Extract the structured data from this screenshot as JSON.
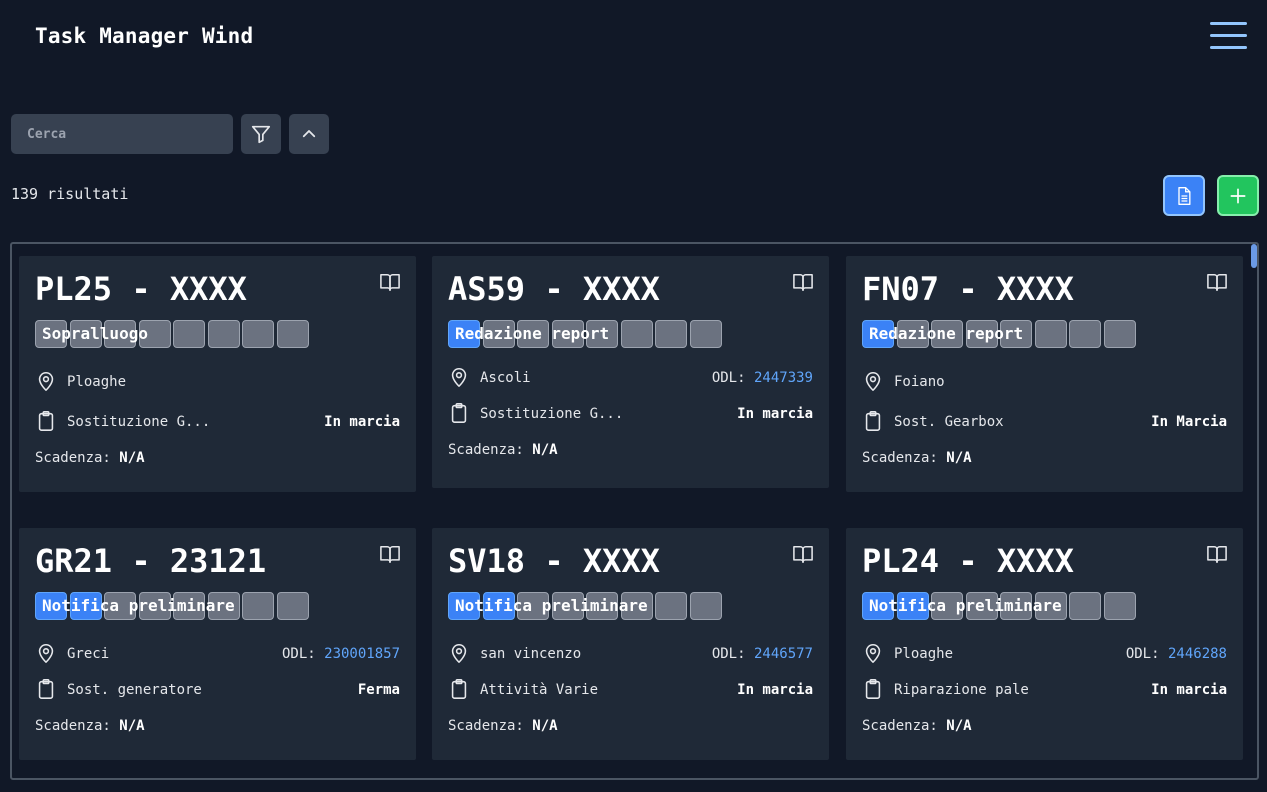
{
  "header": {
    "title": "Task Manager Wind",
    "menu_icon": "hamburger-menu-icon"
  },
  "search": {
    "placeholder": "Cerca",
    "value": ""
  },
  "results": {
    "count_label": "139 risultati"
  },
  "colors": {
    "background": "#111827",
    "card": "#1f2937",
    "accent": "#3b82f6",
    "add": "#22c55e",
    "link": "#60a5fa"
  },
  "labels": {
    "odl": "ODL:",
    "deadline": "Scadenza:"
  },
  "cards": [
    {
      "title": "PL25 - XXXX",
      "stage": "Sopralluogo",
      "steps_done": 0,
      "location": "Ploaghe",
      "odl": "",
      "task": "Sostituzione G...",
      "status": "In marcia",
      "deadline": "N/A"
    },
    {
      "title": "AS59 - XXXX",
      "stage": "Redazione report",
      "steps_done": 1,
      "location": "Ascoli",
      "odl": "2447339",
      "task": "Sostituzione G...",
      "status": "In marcia",
      "deadline": "N/A"
    },
    {
      "title": "FN07 - XXXX",
      "stage": "Redazione report",
      "steps_done": 1,
      "location": "Foiano",
      "odl": "",
      "task": "Sost. Gearbox",
      "status": "In Marcia",
      "deadline": "N/A"
    },
    {
      "title": "GR21 - 23121",
      "stage": "Notifica preliminare",
      "steps_done": 2,
      "location": "Greci",
      "odl": "230001857",
      "task": "Sost. generatore",
      "status": "Ferma",
      "deadline": "N/A"
    },
    {
      "title": "SV18 - XXXX",
      "stage": "Notifica preliminare",
      "steps_done": 2,
      "location": "san vincenzo",
      "odl": "2446577",
      "task": "Attività Varie",
      "status": "In marcia",
      "deadline": "N/A"
    },
    {
      "title": "PL24 - XXXX",
      "stage": "Notifica preliminare",
      "steps_done": 2,
      "location": "Ploaghe",
      "odl": "2446288",
      "task": "Riparazione pale",
      "status": "In marcia",
      "deadline": "N/A"
    }
  ]
}
